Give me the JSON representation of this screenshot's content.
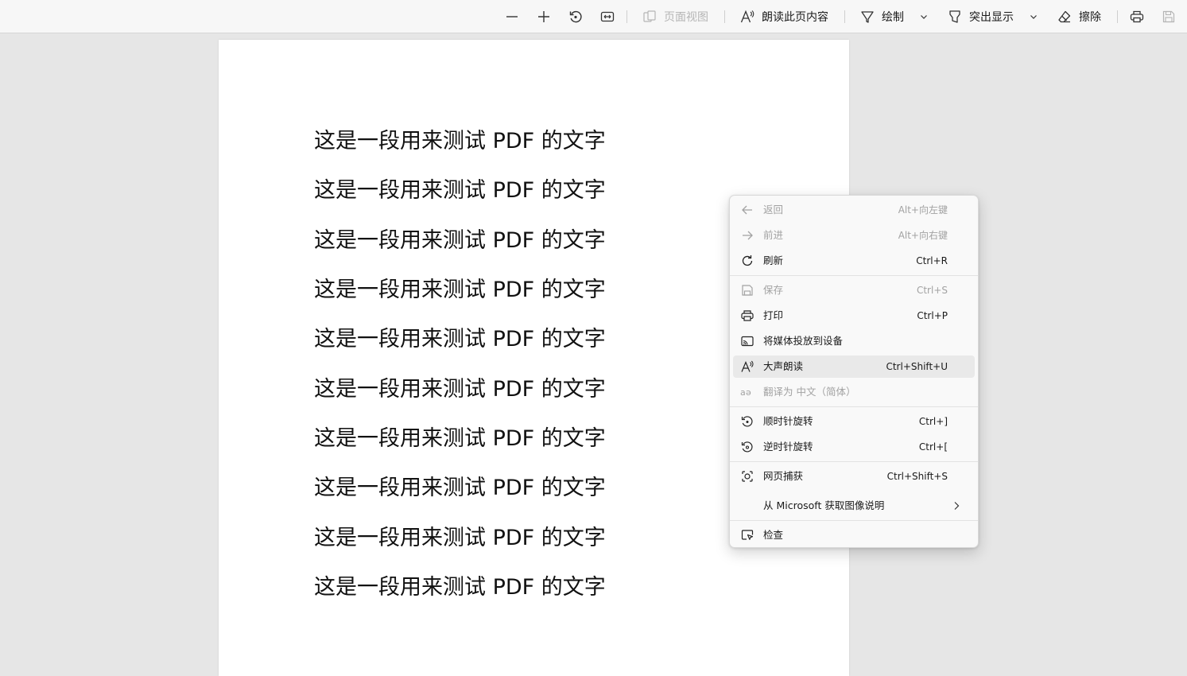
{
  "toolbar": {
    "page_view_label": "页面视图",
    "read_aloud_label": "朗读此页内容",
    "draw_label": "绘制",
    "highlight_label": "突出显示",
    "erase_label": "擦除"
  },
  "document": {
    "lines": [
      "这是一段用来测试 PDF 的文字",
      "这是一段用来测试 PDF 的文字",
      "这是一段用来测试 PDF 的文字",
      "这是一段用来测试 PDF 的文字",
      "这是一段用来测试 PDF 的文字",
      "这是一段用来测试 PDF 的文字",
      "这是一段用来测试 PDF 的文字",
      "这是一段用来测试 PDF 的文字",
      "这是一段用来测试 PDF 的文字",
      "这是一段用来测试 PDF 的文字"
    ]
  },
  "context_menu": {
    "items": [
      {
        "label": "返回",
        "shortcut": "Alt+向左键",
        "icon": "back-arrow-icon",
        "disabled": true
      },
      {
        "label": "前进",
        "shortcut": "Alt+向右键",
        "icon": "forward-arrow-icon",
        "disabled": true
      },
      {
        "label": "刷新",
        "shortcut": "Ctrl+R",
        "icon": "refresh-icon",
        "disabled": false
      },
      {
        "label": "保存",
        "shortcut": "Ctrl+S",
        "icon": "save-icon",
        "disabled": true
      },
      {
        "label": "打印",
        "shortcut": "Ctrl+P",
        "icon": "print-icon",
        "disabled": false
      },
      {
        "label": "将媒体投放到设备",
        "shortcut": "",
        "icon": "cast-icon",
        "disabled": false
      },
      {
        "label": "大声朗读",
        "shortcut": "Ctrl+Shift+U",
        "icon": "read-aloud-icon",
        "disabled": false,
        "hovered": true
      },
      {
        "label": "翻译为 中文（简体）",
        "shortcut": "",
        "icon": "translate-icon",
        "disabled": true
      },
      {
        "label": "顺时针旋转",
        "shortcut": "Ctrl+]",
        "icon": "rotate-clockwise-icon",
        "disabled": false
      },
      {
        "label": "逆时针旋转",
        "shortcut": "Ctrl+[",
        "icon": "rotate-counterclockwise-icon",
        "disabled": false
      },
      {
        "label": "网页捕获",
        "shortcut": "Ctrl+Shift+S",
        "icon": "web-capture-icon",
        "disabled": false
      },
      {
        "label": "从 Microsoft 获取图像说明",
        "shortcut": "",
        "icon": "",
        "disabled": false,
        "submenu": true
      },
      {
        "label": "检查",
        "shortcut": "",
        "icon": "inspect-icon",
        "disabled": false
      }
    ]
  },
  "colors": {
    "background": "#e6e6e6",
    "toolbar": "#f7f7f7",
    "page": "#ffffff",
    "menu": "#f9f9f9",
    "menu_hover": "#e9e9e9",
    "disabled_text": "#a2a2a2"
  }
}
